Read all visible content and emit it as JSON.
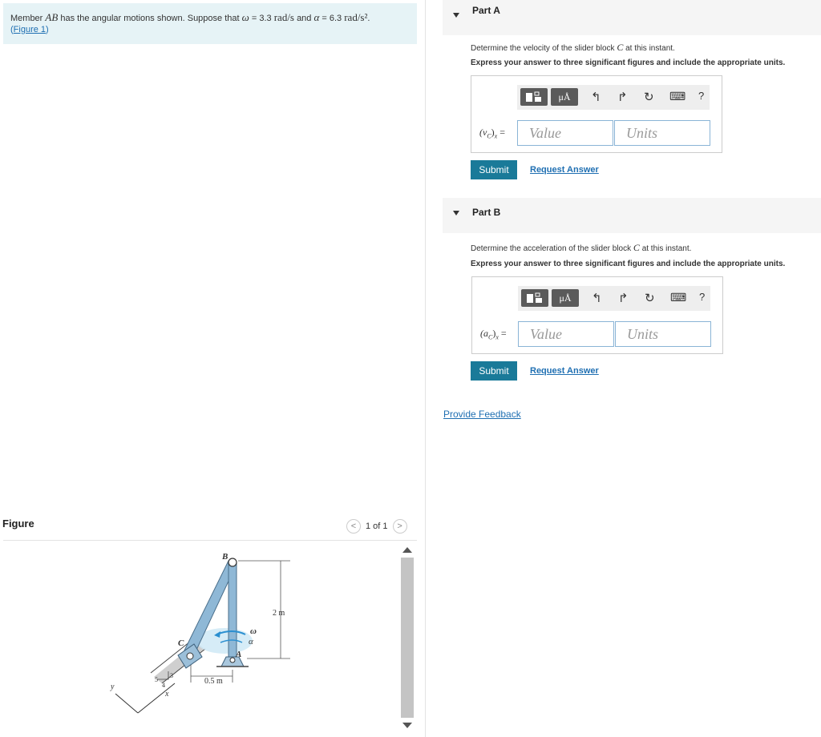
{
  "problem": {
    "text_pre": "Member",
    "member": "AB",
    "text_mid": "has the angular motions shown. Suppose that",
    "omega_sym": "ω",
    "omega_eq": "= 3.3",
    "omega_unit": "rad/s",
    "and": "and",
    "alpha_sym": "α",
    "alpha_eq": "= 6.3",
    "alpha_unit": "rad/s²",
    "period": ".",
    "figure_link": "(Figure 1)",
    "figure_link_open": "(",
    "figure_link_text": "Figure 1",
    "figure_link_close": ")"
  },
  "figure_panel": {
    "title": "Figure",
    "pager": "1 of 1",
    "prev_glyph": "<",
    "next_glyph": ">"
  },
  "figure_labels": {
    "B": "B",
    "C": "C",
    "A": "A",
    "omega": "ω",
    "alpha": "α",
    "len_2m": "2 m",
    "len_05m": "0.5 m",
    "slope_5": "5",
    "slope_4": "4",
    "slope_3": "3",
    "axis_y": "y",
    "axis_x": "x"
  },
  "parts": [
    {
      "title": "Part A",
      "question_pre": "Determine the velocity of the slider block",
      "question_var": "C",
      "question_post": "at this instant.",
      "instruction": "Express your answer to three significant figures and include the appropriate units.",
      "label_main": "(v",
      "label_sub": "C",
      "label_close": ")",
      "label_axis": "x",
      "label_eq": " =",
      "value_placeholder": "Value",
      "units_placeholder": "Units",
      "submit": "Submit",
      "request": "Request Answer"
    },
    {
      "title": "Part B",
      "question_pre": "Determine the acceleration of the slider block",
      "question_var": "C",
      "question_post": "at this instant.",
      "instruction": "Express your answer to three significant figures and include the appropriate units.",
      "label_main": "(a",
      "label_sub": "C",
      "label_close": ")",
      "label_axis": "x",
      "label_eq": " =",
      "value_placeholder": "Value",
      "units_placeholder": "Units",
      "submit": "Submit",
      "request": "Request Answer"
    }
  ],
  "toolbar": {
    "units_btn": "μÅ",
    "undo": "↰",
    "redo": "↱",
    "reset": "↻",
    "keyboard": "⌨",
    "help": "?"
  },
  "feedback": "Provide Feedback"
}
